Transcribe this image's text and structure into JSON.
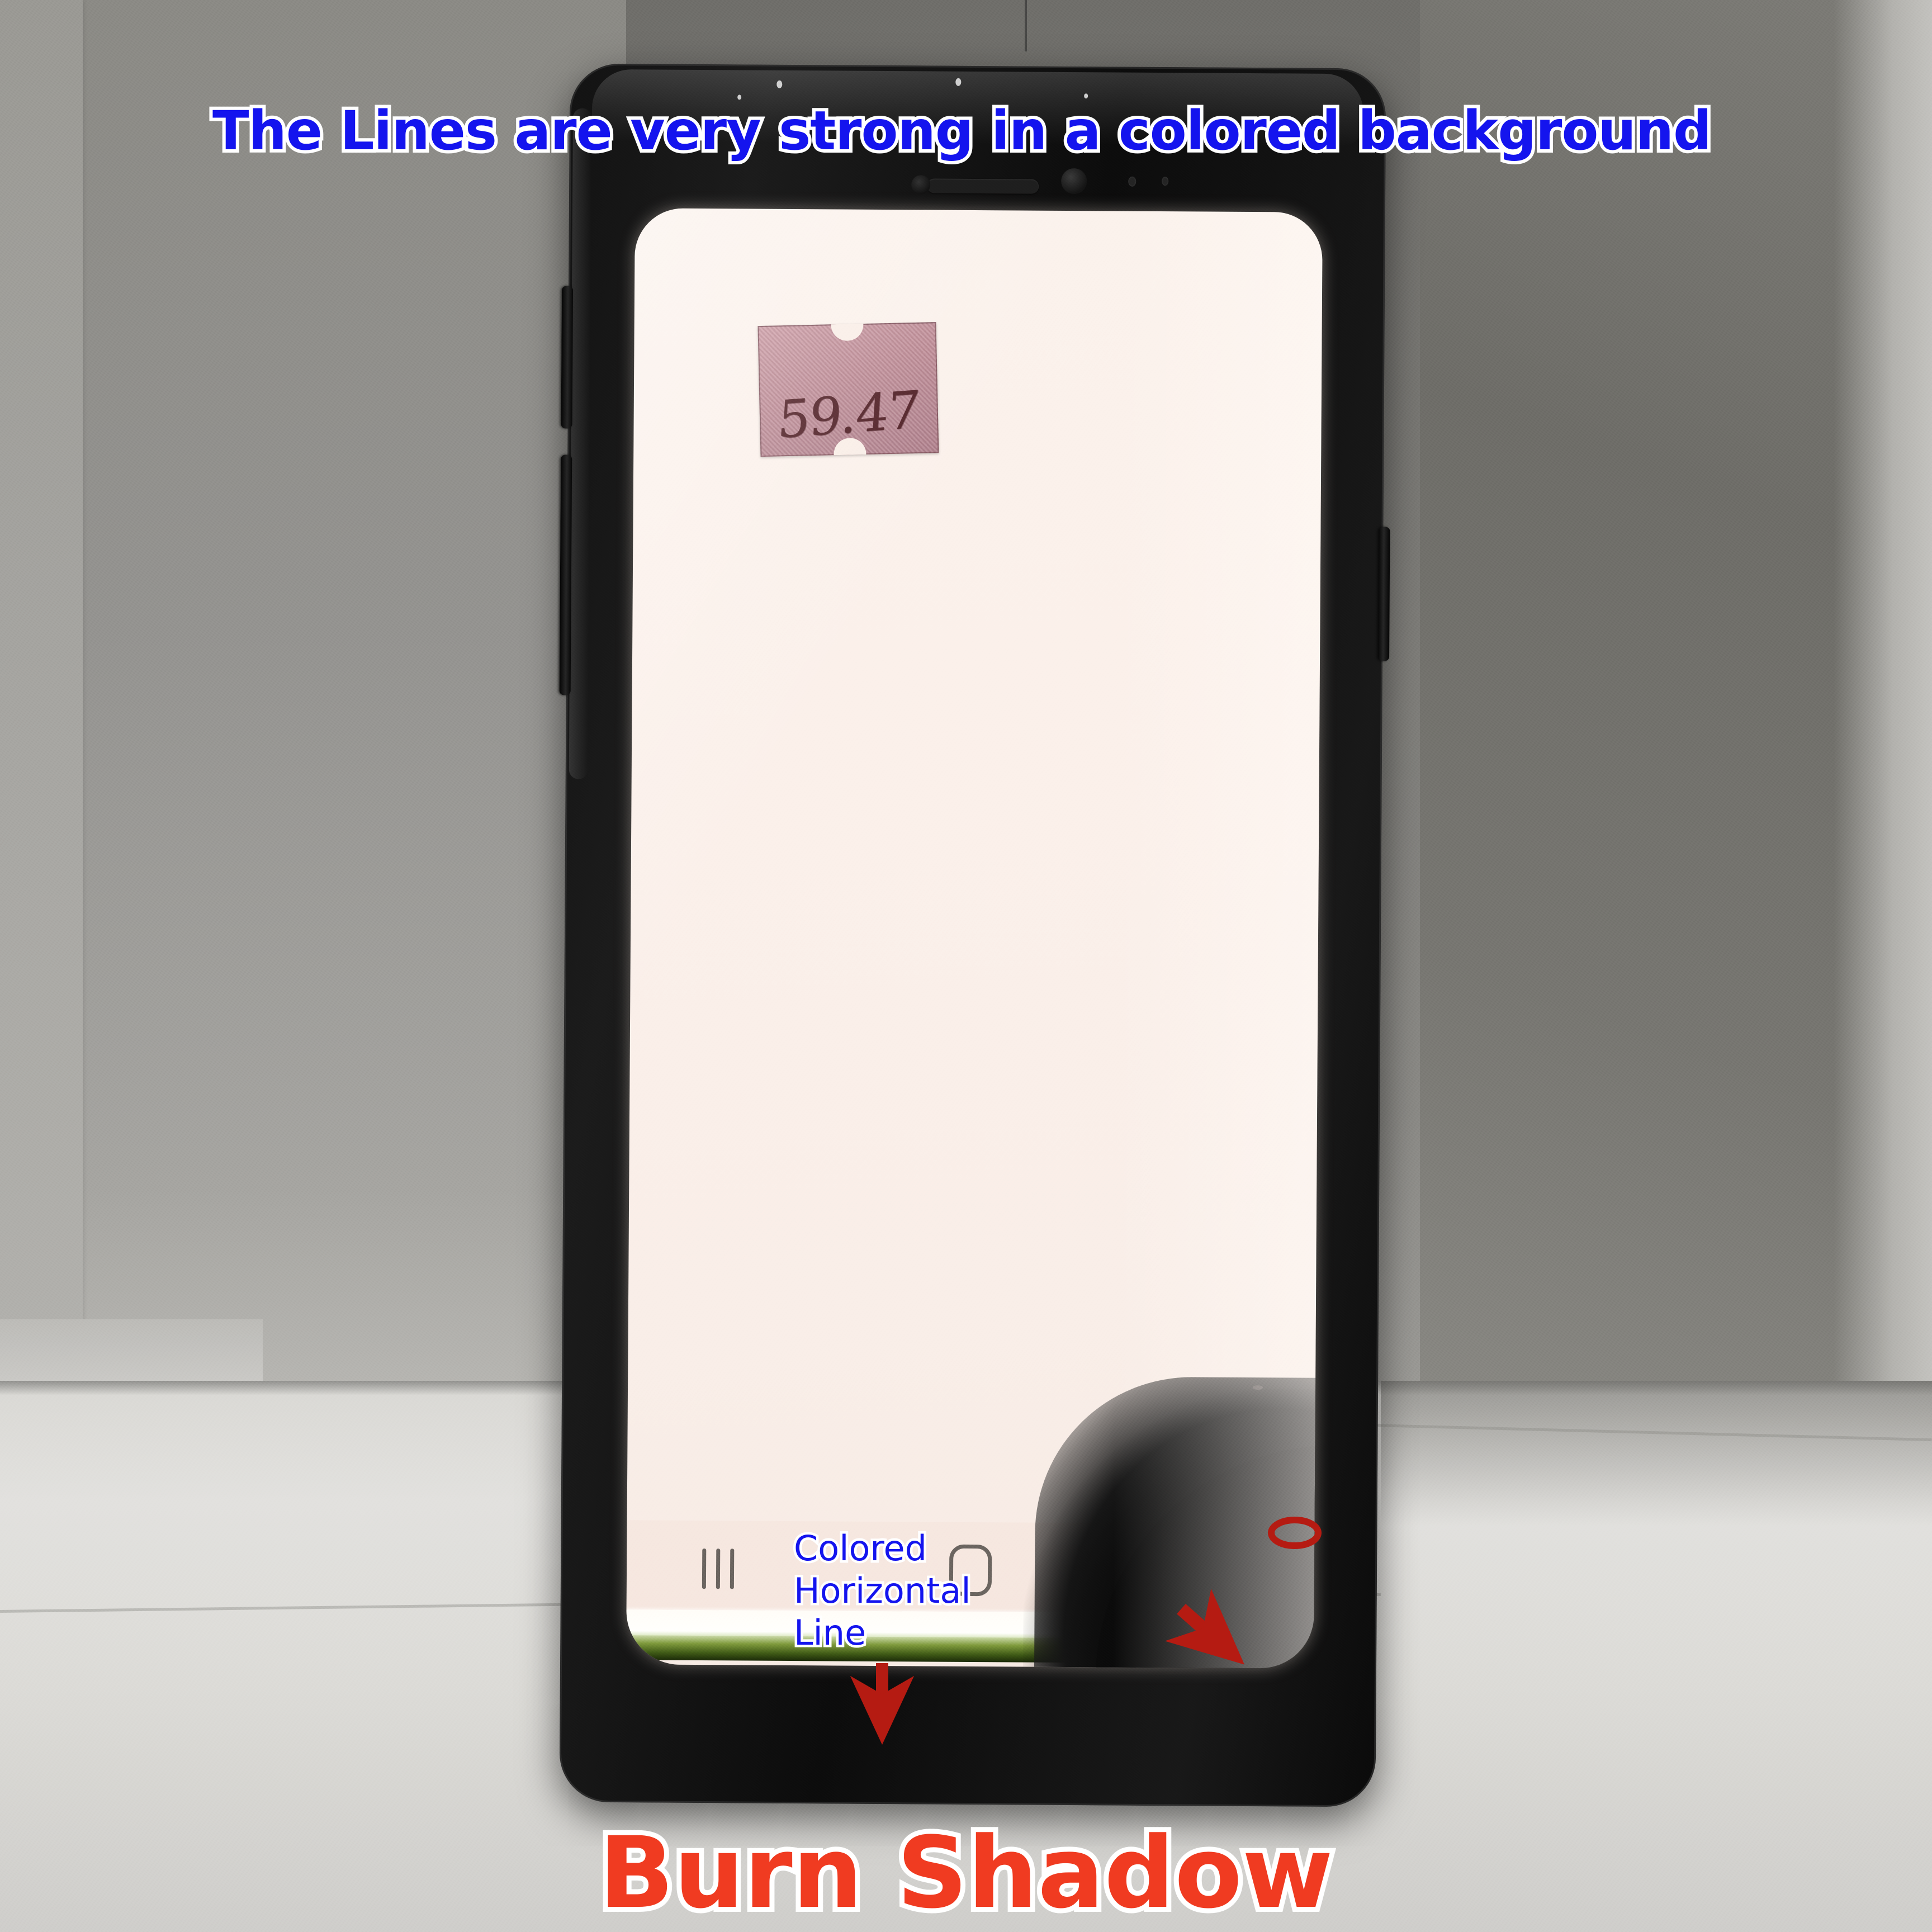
{
  "device": {
    "type": "smartphone",
    "body_color": "#101010",
    "screen_color": "#faf0ea"
  },
  "screen": {
    "sticker": {
      "price": "59.47",
      "label_color": "#bd8893",
      "ink_color": "#4e1d23"
    },
    "navbar": {
      "recents_label": "recents-icon",
      "home_label": "home-icon",
      "back_label": "back-icon"
    },
    "defects": {
      "green_line_color": "#7f9a3c",
      "burn_shadow_color": "#0d0d0d"
    }
  },
  "annotations": {
    "top_caption": "The Lines are very strong in a colored background",
    "top_caption_color": "#1414ee",
    "bottom_caption": "Burn Shadow",
    "bottom_caption_color": "#f03b21",
    "side_caption_line1": "Colored",
    "side_caption_line2": "Horizontal",
    "side_caption_line3": "Line",
    "side_caption_color": "#1414ee",
    "marker_color": "#b51b12"
  }
}
